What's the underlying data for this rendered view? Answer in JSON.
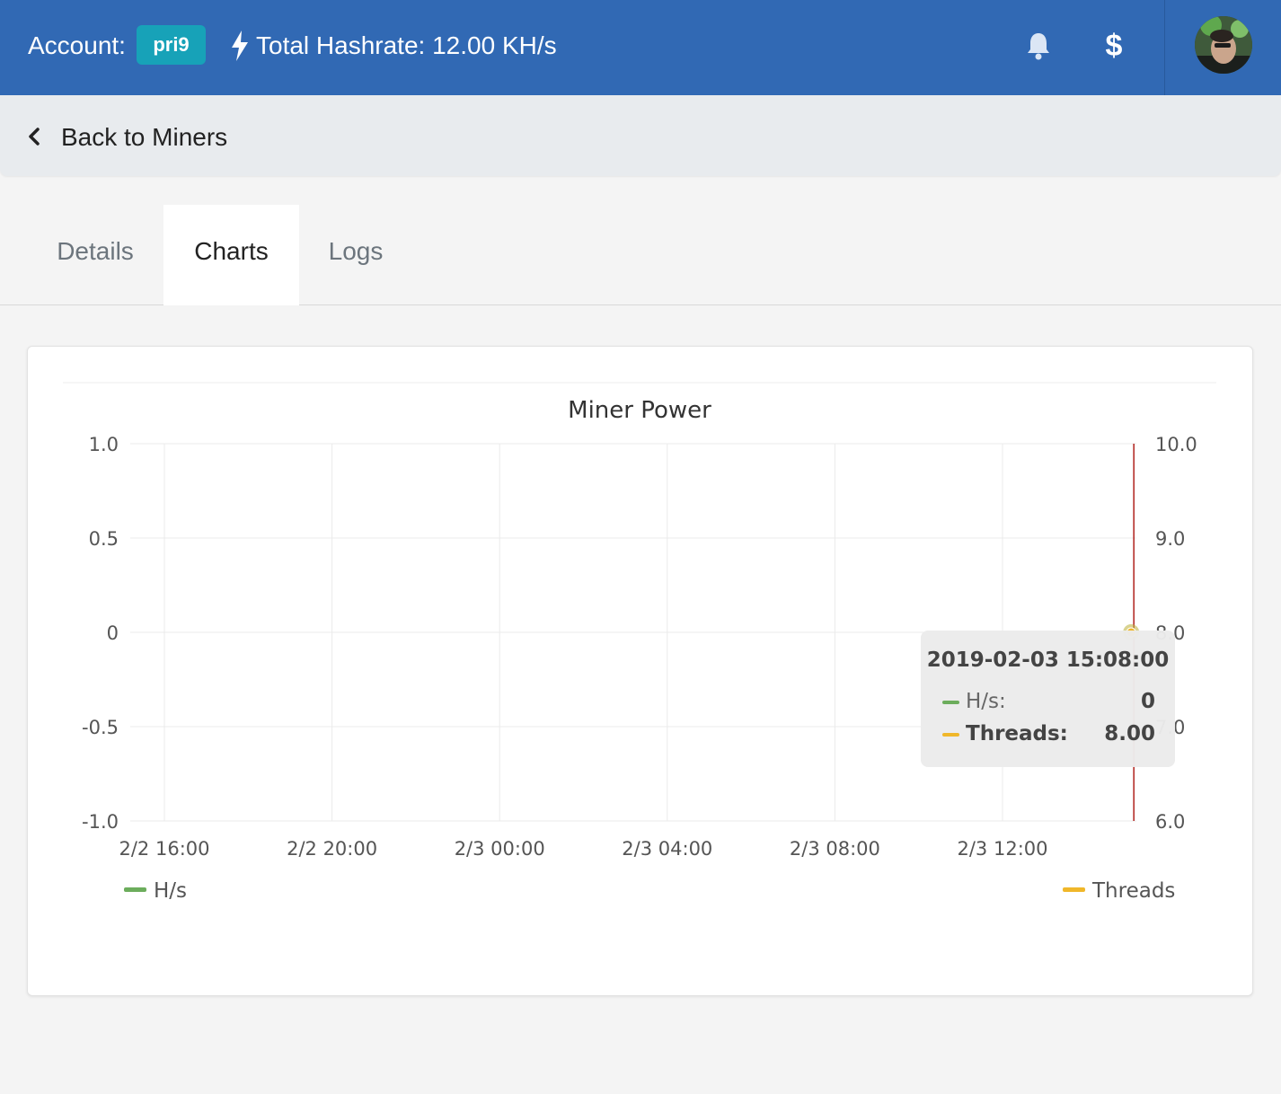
{
  "header": {
    "account_label": "Account:",
    "account_name": "pri9",
    "hashrate_text": "Total Hashrate: 12.00 KH/s",
    "icons": [
      "bolt-icon",
      "bell-icon",
      "dollar-icon",
      "avatar"
    ],
    "dollar_glyph": "$",
    "bg_color": "#3169b4",
    "badge_color": "#17a2b8"
  },
  "subbar": {
    "back_label": "Back to Miners"
  },
  "tabs": [
    {
      "label": "Details",
      "active": false
    },
    {
      "label": "Charts",
      "active": true
    },
    {
      "label": "Logs",
      "active": false
    }
  ],
  "tooltip": {
    "date": "2019-02-03 15:08:00",
    "rows": [
      {
        "name": "H/s:",
        "value": "0",
        "color": "#6cad5c"
      },
      {
        "name": "Threads:",
        "value": "8.00",
        "color": "#f0b72a"
      }
    ]
  },
  "chart_data": {
    "type": "line",
    "title": "Miner Power",
    "x_tick_labels": [
      "2/2 16:00",
      "2/2 20:00",
      "2/3 00:00",
      "2/3 04:00",
      "2/3 08:00",
      "2/3 12:00"
    ],
    "y_left_ticks": [
      "1.0",
      "0.5",
      "0",
      "-0.5",
      "-1.0"
    ],
    "y_left_range": [
      -1.0,
      1.0
    ],
    "y_right_ticks": [
      "10.0",
      "9.0",
      "8.0",
      "7.0",
      "6.0"
    ],
    "y_right_range": [
      6.0,
      10.0
    ],
    "series": [
      {
        "name": "H/s",
        "axis": "left",
        "color": "#6cad5c",
        "points": [
          {
            "x": "2019-02-03 15:08:00",
            "y": 0
          }
        ]
      },
      {
        "name": "Threads",
        "axis": "right",
        "color": "#f0b72a",
        "points": [
          {
            "x": "2019-02-03 15:08:00",
            "y": 8.0
          }
        ]
      }
    ],
    "crosshair_at": "2019-02-03 15:08:00",
    "crosshair_color": "#b0201c",
    "grid": true,
    "legend": [
      "bottom-left",
      "bottom-right"
    ]
  }
}
